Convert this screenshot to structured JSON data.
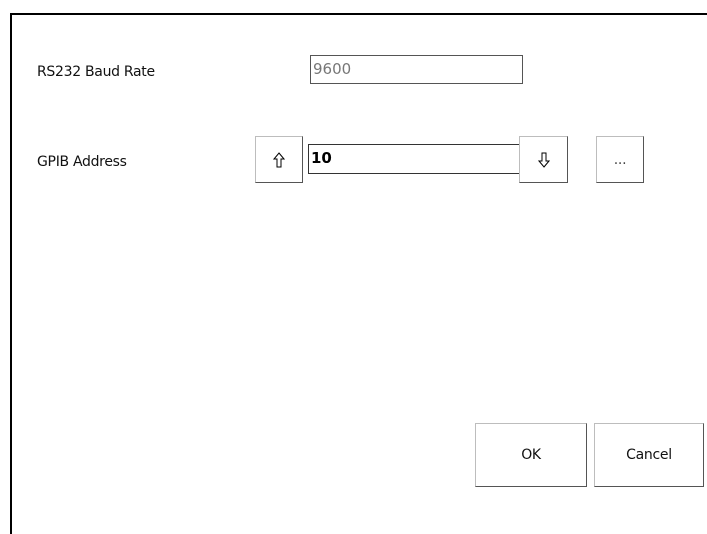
{
  "baud_rate": {
    "label": "RS232 Baud Rate",
    "value": "9600"
  },
  "gpib": {
    "label": "GPIB Address",
    "value": "10",
    "up_icon": "arrow-up-icon",
    "down_icon": "arrow-down-icon",
    "browse_label": "..."
  },
  "footer": {
    "ok_label": "OK",
    "cancel_label": "Cancel"
  }
}
